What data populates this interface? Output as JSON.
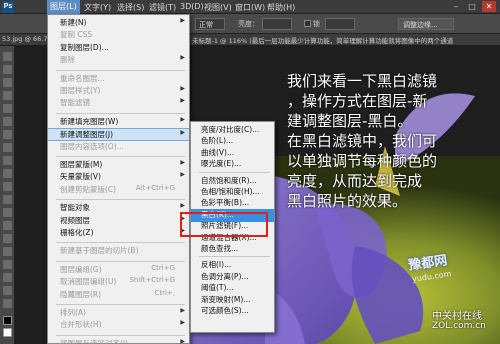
{
  "menubar": {
    "logo": "Ps",
    "items": [
      "图层(L)",
      "文字(Y)",
      "选择(S)",
      "滤镜(T)",
      "3D(D)",
      "视图(V)",
      "窗口(W)",
      "帮助(H)"
    ],
    "active_index": 0,
    "window_buttons": [
      "–",
      "□",
      "✕"
    ]
  },
  "options_bar": {
    "mode_value": "正常",
    "brightness_label": "亮度：",
    "lock_label": "锁",
    "align_button": "调整边缘..."
  },
  "tab_bar": {
    "tab_left": "53.jpg @ 66.7%",
    "tab_right": "未标题-1 @ 116% (最后一层功能最少计算功能，简单理解计算功能就将图像中的两个通道"
  },
  "layer_menu": {
    "items": [
      {
        "label": "新建(N)",
        "arrow": true
      },
      {
        "label": "复制 CSS",
        "disabled": true
      },
      {
        "label": "复制图层(D)..."
      },
      {
        "label": "删除",
        "arrow": true,
        "disabled": true
      },
      {
        "sep": true
      },
      {
        "label": "重命名图层...",
        "disabled": true
      },
      {
        "label": "图层样式(Y)",
        "arrow": true,
        "disabled": true
      },
      {
        "label": "智能滤镜",
        "arrow": true,
        "disabled": true
      },
      {
        "sep": true
      },
      {
        "label": "新建填充图层(W)",
        "arrow": true
      },
      {
        "label": "新建调整图层(J)",
        "arrow": true,
        "highlight": true
      },
      {
        "label": "图层内容选项(O)...",
        "disabled": true
      },
      {
        "sep": true
      },
      {
        "label": "图层蒙版(M)",
        "arrow": true
      },
      {
        "label": "矢量蒙版(V)",
        "arrow": true
      },
      {
        "label": "创建剪贴蒙版(C)",
        "shortcut": "Alt+Ctrl+G",
        "disabled": true
      },
      {
        "sep": true
      },
      {
        "label": "智能对象",
        "arrow": true
      },
      {
        "label": "视频图层",
        "arrow": true
      },
      {
        "label": "栅格化(Z)",
        "arrow": true
      },
      {
        "sep": true
      },
      {
        "label": "新建基于图层的切片(B)",
        "disabled": true
      },
      {
        "sep": true
      },
      {
        "label": "图层编组(G)",
        "shortcut": "Ctrl+G",
        "disabled": true
      },
      {
        "label": "取消图层编组(U)",
        "shortcut": "Shift+Ctrl+G",
        "disabled": true
      },
      {
        "label": "隐藏图层(R)",
        "shortcut": "Ctrl+,",
        "disabled": true
      },
      {
        "sep": true
      },
      {
        "label": "排列(A)",
        "arrow": true,
        "disabled": true
      },
      {
        "label": "合并形状(H)",
        "arrow": true,
        "disabled": true
      },
      {
        "sep": true
      },
      {
        "label": "将图层与选区对齐(I)",
        "arrow": true,
        "disabled": true
      }
    ]
  },
  "adjustment_menu": {
    "items": [
      {
        "label": "亮度/对比度(C)..."
      },
      {
        "label": "色阶(L)..."
      },
      {
        "label": "曲线(V)..."
      },
      {
        "label": "曝光度(E)..."
      },
      {
        "sep": true
      },
      {
        "label": "自然饱和度(R)..."
      },
      {
        "label": "色相/饱和度(H)..."
      },
      {
        "label": "色彩平衡(B)..."
      },
      {
        "label": "黑白(K)...",
        "highlight": true
      },
      {
        "label": "照片滤镜(F)..."
      },
      {
        "label": "通道混合器(X)..."
      },
      {
        "label": "颜色查找..."
      },
      {
        "sep": true
      },
      {
        "label": "反相(I)..."
      },
      {
        "label": "色调分离(P)..."
      },
      {
        "label": "阈值(T)..."
      },
      {
        "label": "渐变映射(M)..."
      },
      {
        "label": "可选颜色(S)..."
      }
    ]
  },
  "caption": {
    "lines": [
      "我们来看一下黑白滤镜",
      "，操作方式在图层-新",
      "建调整图层-黑白。",
      "在黑白滤镜中，我们可",
      "以单独调节每种颜色的",
      "亮度，从而达到完成",
      "黑白照片的效果。"
    ]
  },
  "watermark": {
    "brand": "豫都网",
    "url": "yudu.com",
    "site_cn": "中关村在线",
    "site_en": "ZOL.com.cn"
  },
  "colors": {
    "menu_bg": "#f0f0f0",
    "highlight": "#3b8fe0",
    "red_box": "#e0201a",
    "petal": "#7b63c9"
  }
}
